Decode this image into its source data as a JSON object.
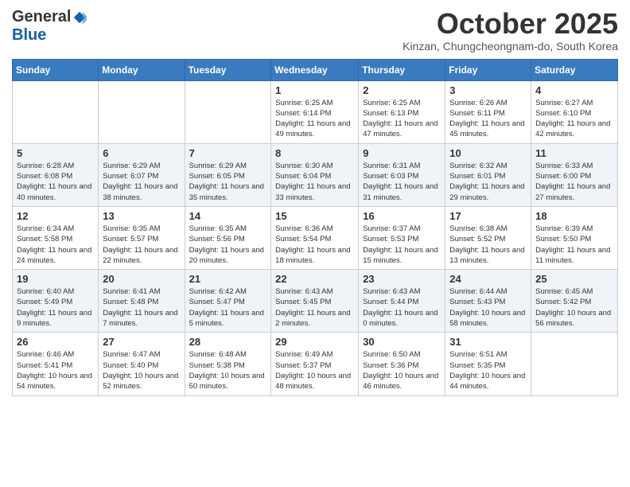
{
  "logo": {
    "general": "General",
    "blue": "Blue"
  },
  "header": {
    "month": "October 2025",
    "location": "Kinzan, Chungcheongnam-do, South Korea"
  },
  "weekdays": [
    "Sunday",
    "Monday",
    "Tuesday",
    "Wednesday",
    "Thursday",
    "Friday",
    "Saturday"
  ],
  "weeks": [
    [
      {
        "day": "",
        "info": ""
      },
      {
        "day": "",
        "info": ""
      },
      {
        "day": "",
        "info": ""
      },
      {
        "day": "1",
        "info": "Sunrise: 6:25 AM\nSunset: 6:14 PM\nDaylight: 11 hours and 49 minutes."
      },
      {
        "day": "2",
        "info": "Sunrise: 6:25 AM\nSunset: 6:13 PM\nDaylight: 11 hours and 47 minutes."
      },
      {
        "day": "3",
        "info": "Sunrise: 6:26 AM\nSunset: 6:11 PM\nDaylight: 11 hours and 45 minutes."
      },
      {
        "day": "4",
        "info": "Sunrise: 6:27 AM\nSunset: 6:10 PM\nDaylight: 11 hours and 42 minutes."
      }
    ],
    [
      {
        "day": "5",
        "info": "Sunrise: 6:28 AM\nSunset: 6:08 PM\nDaylight: 11 hours and 40 minutes."
      },
      {
        "day": "6",
        "info": "Sunrise: 6:29 AM\nSunset: 6:07 PM\nDaylight: 11 hours and 38 minutes."
      },
      {
        "day": "7",
        "info": "Sunrise: 6:29 AM\nSunset: 6:05 PM\nDaylight: 11 hours and 35 minutes."
      },
      {
        "day": "8",
        "info": "Sunrise: 6:30 AM\nSunset: 6:04 PM\nDaylight: 11 hours and 33 minutes."
      },
      {
        "day": "9",
        "info": "Sunrise: 6:31 AM\nSunset: 6:03 PM\nDaylight: 11 hours and 31 minutes."
      },
      {
        "day": "10",
        "info": "Sunrise: 6:32 AM\nSunset: 6:01 PM\nDaylight: 11 hours and 29 minutes."
      },
      {
        "day": "11",
        "info": "Sunrise: 6:33 AM\nSunset: 6:00 PM\nDaylight: 11 hours and 27 minutes."
      }
    ],
    [
      {
        "day": "12",
        "info": "Sunrise: 6:34 AM\nSunset: 5:58 PM\nDaylight: 11 hours and 24 minutes."
      },
      {
        "day": "13",
        "info": "Sunrise: 6:35 AM\nSunset: 5:57 PM\nDaylight: 11 hours and 22 minutes."
      },
      {
        "day": "14",
        "info": "Sunrise: 6:35 AM\nSunset: 5:56 PM\nDaylight: 11 hours and 20 minutes."
      },
      {
        "day": "15",
        "info": "Sunrise: 6:36 AM\nSunset: 5:54 PM\nDaylight: 11 hours and 18 minutes."
      },
      {
        "day": "16",
        "info": "Sunrise: 6:37 AM\nSunset: 5:53 PM\nDaylight: 11 hours and 15 minutes."
      },
      {
        "day": "17",
        "info": "Sunrise: 6:38 AM\nSunset: 5:52 PM\nDaylight: 11 hours and 13 minutes."
      },
      {
        "day": "18",
        "info": "Sunrise: 6:39 AM\nSunset: 5:50 PM\nDaylight: 11 hours and 11 minutes."
      }
    ],
    [
      {
        "day": "19",
        "info": "Sunrise: 6:40 AM\nSunset: 5:49 PM\nDaylight: 11 hours and 9 minutes."
      },
      {
        "day": "20",
        "info": "Sunrise: 6:41 AM\nSunset: 5:48 PM\nDaylight: 11 hours and 7 minutes."
      },
      {
        "day": "21",
        "info": "Sunrise: 6:42 AM\nSunset: 5:47 PM\nDaylight: 11 hours and 5 minutes."
      },
      {
        "day": "22",
        "info": "Sunrise: 6:43 AM\nSunset: 5:45 PM\nDaylight: 11 hours and 2 minutes."
      },
      {
        "day": "23",
        "info": "Sunrise: 6:43 AM\nSunset: 5:44 PM\nDaylight: 11 hours and 0 minutes."
      },
      {
        "day": "24",
        "info": "Sunrise: 6:44 AM\nSunset: 5:43 PM\nDaylight: 10 hours and 58 minutes."
      },
      {
        "day": "25",
        "info": "Sunrise: 6:45 AM\nSunset: 5:42 PM\nDaylight: 10 hours and 56 minutes."
      }
    ],
    [
      {
        "day": "26",
        "info": "Sunrise: 6:46 AM\nSunset: 5:41 PM\nDaylight: 10 hours and 54 minutes."
      },
      {
        "day": "27",
        "info": "Sunrise: 6:47 AM\nSunset: 5:40 PM\nDaylight: 10 hours and 52 minutes."
      },
      {
        "day": "28",
        "info": "Sunrise: 6:48 AM\nSunset: 5:38 PM\nDaylight: 10 hours and 50 minutes."
      },
      {
        "day": "29",
        "info": "Sunrise: 6:49 AM\nSunset: 5:37 PM\nDaylight: 10 hours and 48 minutes."
      },
      {
        "day": "30",
        "info": "Sunrise: 6:50 AM\nSunset: 5:36 PM\nDaylight: 10 hours and 46 minutes."
      },
      {
        "day": "31",
        "info": "Sunrise: 6:51 AM\nSunset: 5:35 PM\nDaylight: 10 hours and 44 minutes."
      },
      {
        "day": "",
        "info": ""
      }
    ]
  ]
}
